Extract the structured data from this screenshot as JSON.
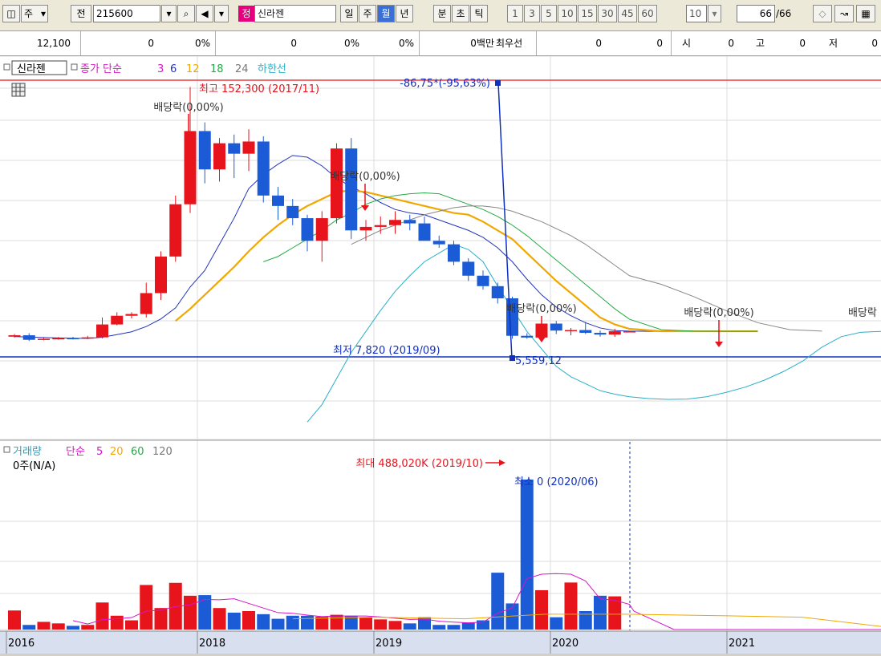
{
  "toolbar": {
    "period_options": [
      "주"
    ],
    "prev_label": "전",
    "code": "215600",
    "search_icon": "search-icon",
    "stock_tag": "정",
    "stock_name": "신라젠",
    "timeframes": [
      "일",
      "주",
      "월",
      "년"
    ],
    "timeframes2": [
      "분",
      "초",
      "틱"
    ],
    "intervals": [
      "1",
      "3",
      "5",
      "10",
      "15",
      "30",
      "45",
      "60"
    ],
    "count_select": "10",
    "page_current": "66",
    "page_total": "/66"
  },
  "quote": {
    "price": "12,100",
    "change": "0",
    "change_pct": "0%",
    "volume": "0",
    "vol_pct": "0%",
    "vol_pct2": "0%",
    "amount": "0백만",
    "label_best": "최우선",
    "best1": "0",
    "best2": "0",
    "label_open": "시",
    "open": "0",
    "label_high": "고",
    "high": "0",
    "label_low": "저",
    "low": "0"
  },
  "price_legend": {
    "name": "신라젠",
    "ma_label": "종가 단순",
    "periods": [
      "3",
      "6",
      "12",
      "18",
      "24"
    ],
    "lower_label": "하한선"
  },
  "volume_legend": {
    "name": "거래량",
    "ma_label": "단순",
    "periods": [
      "5",
      "20",
      "60",
      "120"
    ],
    "value_text": "0주(N/A)"
  },
  "annotations": {
    "high": "최고 152,300 (2017/11)",
    "low": "최저 7,820 (2019/09)",
    "crosshair_change": "-86,75*(-95,63%)",
    "crosshair_value": "5,559,12",
    "dividend": "배당락(0,00%)",
    "dividend_cut": "배당락",
    "vol_max": "최대 488,020K (2019/10)",
    "vol_min": "최소 0 (2020/06)"
  },
  "colors": {
    "up": "#e8141c",
    "down": "#1c5bd6",
    "ma3": "#d616c8",
    "ma6": "#2233bb",
    "ma12": "#f0a800",
    "ma18": "#22aa44",
    "ma24": "#888888",
    "lower": "#28b0c8"
  },
  "chart_data": {
    "type": "candlestick",
    "price_unit": "KRW",
    "x_axis_labels": [
      "2016",
      "2018",
      "2019",
      "2020",
      "2021"
    ],
    "price_range": [
      -50000,
      170000
    ],
    "candles": [
      {
        "o": 9000,
        "h": 10500,
        "l": 8500,
        "c": 9800
      },
      {
        "o": 9800,
        "h": 11000,
        "l": 6500,
        "c": 7200
      },
      {
        "o": 7200,
        "h": 8200,
        "l": 6900,
        "c": 7800
      },
      {
        "o": 7800,
        "h": 8800,
        "l": 7300,
        "c": 8200
      },
      {
        "o": 8200,
        "h": 8900,
        "l": 7400,
        "c": 7900
      },
      {
        "o": 7900,
        "h": 9500,
        "l": 7600,
        "c": 8600
      },
      {
        "o": 8600,
        "h": 20000,
        "l": 8000,
        "c": 16000
      },
      {
        "o": 16000,
        "h": 23000,
        "l": 15500,
        "c": 21000
      },
      {
        "o": 21000,
        "h": 23000,
        "l": 19500,
        "c": 22000
      },
      {
        "o": 22000,
        "h": 40000,
        "l": 20000,
        "c": 34000
      },
      {
        "o": 34000,
        "h": 58000,
        "l": 30000,
        "c": 55000
      },
      {
        "o": 55000,
        "h": 90000,
        "l": 52000,
        "c": 85000
      },
      {
        "o": 85000,
        "h": 152300,
        "l": 80000,
        "c": 127000
      },
      {
        "o": 127000,
        "h": 132000,
        "l": 97000,
        "c": 105000
      },
      {
        "o": 105000,
        "h": 123000,
        "l": 98000,
        "c": 120000
      },
      {
        "o": 120000,
        "h": 125000,
        "l": 100000,
        "c": 114000
      },
      {
        "o": 114000,
        "h": 128000,
        "l": 104000,
        "c": 121000
      },
      {
        "o": 121000,
        "h": 124000,
        "l": 86000,
        "c": 90000
      },
      {
        "o": 90000,
        "h": 95000,
        "l": 76000,
        "c": 84000
      },
      {
        "o": 84000,
        "h": 88000,
        "l": 73000,
        "c": 77000
      },
      {
        "o": 77000,
        "h": 79000,
        "l": 58000,
        "c": 64000
      },
      {
        "o": 64000,
        "h": 81000,
        "l": 52000,
        "c": 77000
      },
      {
        "o": 77000,
        "h": 120000,
        "l": 74000,
        "c": 117000
      },
      {
        "o": 117000,
        "h": 123000,
        "l": 65000,
        "c": 70000
      },
      {
        "o": 70000,
        "h": 76000,
        "l": 64000,
        "c": 72000
      },
      {
        "o": 72000,
        "h": 78000,
        "l": 68000,
        "c": 73000
      },
      {
        "o": 73000,
        "h": 81000,
        "l": 68000,
        "c": 76000
      },
      {
        "o": 76000,
        "h": 79000,
        "l": 70000,
        "c": 74000
      },
      {
        "o": 74000,
        "h": 78000,
        "l": 67000,
        "c": 64000
      },
      {
        "o": 64000,
        "h": 67000,
        "l": 60000,
        "c": 62000
      },
      {
        "o": 62000,
        "h": 64000,
        "l": 50000,
        "c": 52000
      },
      {
        "o": 52000,
        "h": 54000,
        "l": 41000,
        "c": 44000
      },
      {
        "o": 44000,
        "h": 47000,
        "l": 36000,
        "c": 38000
      },
      {
        "o": 38000,
        "h": 40000,
        "l": 28000,
        "c": 31000
      },
      {
        "o": 31000,
        "h": 32000,
        "l": 7820,
        "c": 9500
      },
      {
        "o": 9500,
        "h": 11000,
        "l": 7820,
        "c": 8500
      },
      {
        "o": 8500,
        "h": 17000,
        "l": 8200,
        "c": 16500
      },
      {
        "o": 16500,
        "h": 18000,
        "l": 10500,
        "c": 12500
      },
      {
        "o": 12500,
        "h": 14000,
        "l": 9800,
        "c": 12800
      },
      {
        "o": 12800,
        "h": 17500,
        "l": 10500,
        "c": 11200
      },
      {
        "o": 11200,
        "h": 12500,
        "l": 9000,
        "c": 10200
      },
      {
        "o": 10200,
        "h": 13500,
        "l": 8900,
        "c": 12100
      },
      {
        "o": 12100,
        "h": 12300,
        "l": 11800,
        "c": 12100
      }
    ],
    "ma_series": [
      {
        "name": "6",
        "values": [
          9000,
          8800,
          8500,
          8300,
          8100,
          8000,
          8700,
          10200,
          11800,
          14800,
          19200,
          25500,
          37500,
          47000,
          62000,
          77000,
          94000,
          102000,
          108000,
          113000,
          112000,
          107000,
          100000,
          95000,
          91000,
          86000,
          82000,
          80000,
          79000,
          76000,
          73000,
          70000,
          66000,
          60000,
          52000,
          42000,
          33000,
          26000,
          21000,
          17000,
          14000,
          12500,
          12200
        ]
      },
      {
        "name": "12",
        "values": [
          null,
          null,
          null,
          null,
          null,
          null,
          null,
          null,
          null,
          null,
          null,
          18000,
          25000,
          33000,
          41000,
          49000,
          58000,
          66000,
          73000,
          79000,
          84000,
          88000,
          92000,
          93000,
          92000,
          90000,
          88000,
          86000,
          84000,
          82000,
          80000,
          79000,
          75000,
          70000,
          65000,
          57000,
          49000,
          41000,
          34000,
          27000,
          20000,
          16000,
          13500
        ]
      },
      {
        "name": "18",
        "values": [
          null,
          null,
          null,
          null,
          null,
          null,
          null,
          null,
          null,
          null,
          null,
          null,
          null,
          null,
          null,
          null,
          null,
          52000,
          55000,
          60000,
          65000,
          70000,
          76000,
          80000,
          85000,
          88000,
          90000,
          91000,
          91500,
          91000,
          88000,
          85000,
          82000,
          78000,
          73000,
          67000,
          60000,
          53000,
          46000,
          39000,
          32000,
          25000,
          19000
        ]
      },
      {
        "name": "24",
        "values": [
          null,
          null,
          null,
          null,
          null,
          null,
          null,
          null,
          null,
          null,
          null,
          null,
          null,
          null,
          null,
          null,
          null,
          null,
          null,
          null,
          null,
          null,
          null,
          62000,
          66000,
          70000,
          73000,
          76000,
          79000,
          81000,
          83000,
          84000,
          84000,
          83000,
          81000,
          78000,
          75000,
          71000,
          67000,
          62000,
          56000,
          50000,
          44000
        ]
      }
    ],
    "ma_tail": {
      "6": [
        12000,
        12000,
        12000
      ],
      "12": [
        12100,
        12100,
        12100,
        12100
      ],
      "18": [
        13000,
        12200,
        12100,
        12100
      ],
      "24": [
        39000,
        32000,
        24000,
        17000,
        13000,
        12200
      ]
    },
    "lower_band": [
      null,
      null,
      null,
      null,
      null,
      null,
      null,
      null,
      null,
      null,
      null,
      null,
      null,
      null,
      null,
      null,
      null,
      null,
      null,
      null,
      -40000,
      -30000,
      -15000,
      0,
      12000,
      24000,
      35000,
      44000,
      52000,
      57000,
      62000,
      59000,
      52000,
      38000,
      25000,
      12000,
      2000,
      -8000,
      -14000,
      -18000,
      -22000,
      -24000,
      -25500
    ],
    "lower_band_tail": [
      -26500,
      -27000,
      -26800,
      -25500,
      -23000,
      -20000,
      -16000,
      -11000,
      -5000,
      3000,
      9000,
      11500,
      12000,
      12100
    ],
    "volume": {
      "unit": "K",
      "max": 488020,
      "values": [
        62000,
        15000,
        25000,
        20000,
        12000,
        15000,
        88000,
        45000,
        30000,
        145000,
        70000,
        152000,
        110000,
        112000,
        70000,
        55000,
        60000,
        50000,
        35000,
        45000,
        45000,
        42000,
        48000,
        45000,
        40000,
        33000,
        28000,
        20000,
        40000,
        15000,
        15000,
        22000,
        30000,
        185000,
        85000,
        488020,
        128000,
        40000,
        153000,
        60000,
        110000,
        108000,
        0
      ],
      "ma5": [
        null,
        null,
        null,
        null,
        29000,
        18000,
        32000,
        35000,
        39000,
        60000,
        63000,
        75000,
        80000,
        98000,
        97000,
        100000,
        85000,
        70000,
        55000,
        53000,
        47000,
        42000,
        44000,
        44000,
        44000,
        41000,
        37000,
        33000,
        34000,
        27000,
        24000,
        22000,
        24000,
        53000,
        71000,
        166000,
        180000,
        182000,
        180000,
        158000,
        100000,
        95000,
        82000
      ]
    }
  }
}
